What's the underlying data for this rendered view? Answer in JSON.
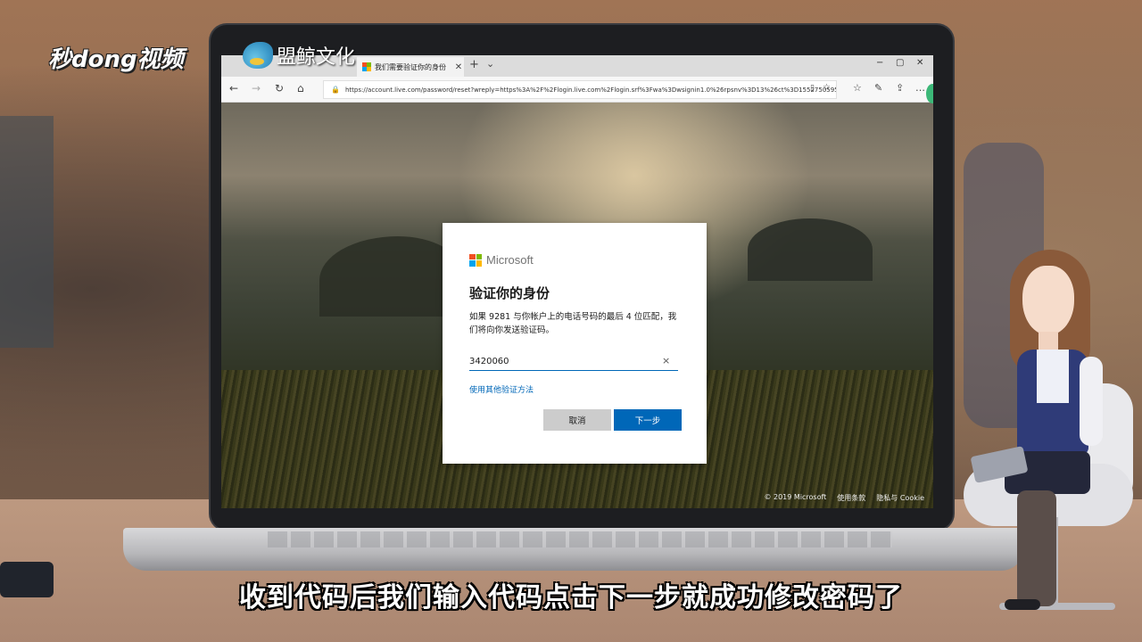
{
  "overlay": {
    "channel_logo": "秒dong视频",
    "brand_name": "盟鲸文化",
    "subtitle": "收到代码后我们输入代码点击下一步就成功修改密码了"
  },
  "browser": {
    "tab_title": "我们需要验证你的身份",
    "tab_close": "✕",
    "new_tab": "+",
    "tab_menu": "⌄",
    "url": "https://account.live.com/password/reset?wreply=https%3A%2F%2Flogin.live.com%2Flogin.srf%3Fwa%3Dwsignin1.0%26rpsnv%3D13%26ct%3D1552750595"
  },
  "dialog": {
    "brand": "Microsoft",
    "title": "验证你的身份",
    "description": "如果 9281 与你帐户上的电话号码的最后 4 位匹配，我们将向你发送验证码。",
    "code_value": "3420060",
    "clear_icon": "×",
    "alt_method_link": "使用其他验证方法",
    "cancel_label": "取消",
    "next_label": "下一步"
  },
  "footer": {
    "copyright": "© 2019 Microsoft",
    "terms": "使用条款",
    "privacy": "隐私与 Cookie"
  },
  "colors": {
    "ms_red": "#f25022",
    "ms_green": "#7fba00",
    "ms_blue": "#00a4ef",
    "ms_yellow": "#ffb900",
    "primary_button": "#0067b8"
  }
}
